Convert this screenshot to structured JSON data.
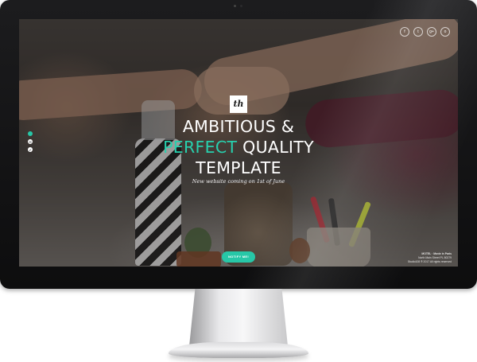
{
  "social": {
    "icons": [
      {
        "name": "facebook-icon",
        "glyph": "f"
      },
      {
        "name": "twitter-icon",
        "glyph": "t"
      },
      {
        "name": "google-plus-icon",
        "glyph": "g+"
      },
      {
        "name": "dribbble-icon",
        "glyph": "o"
      }
    ]
  },
  "side_nav": {
    "dots": [
      {
        "name": "side-dot-1",
        "active": true,
        "glyph": ""
      },
      {
        "name": "side-dot-2",
        "active": false,
        "glyph": "✉"
      },
      {
        "name": "side-dot-3",
        "active": false,
        "glyph": "✔"
      }
    ]
  },
  "hero": {
    "logo": "th",
    "line1": "AMBITIOUS &",
    "line2_accent": "PERFECT",
    "line2_rest": " QUALITY",
    "line3": "TEMPLATE",
    "subtitle": "New website coming on 1st of June",
    "cta_label": "NOTIFY ME!"
  },
  "address": {
    "name": "MOTEL · Movie in Paris",
    "line1": "North Main Street PL 80279",
    "line2": "Studio108 ® 2017 All rights reserved"
  },
  "colors": {
    "accent": "#27c7a7",
    "monitor_bezel": "#111111"
  }
}
